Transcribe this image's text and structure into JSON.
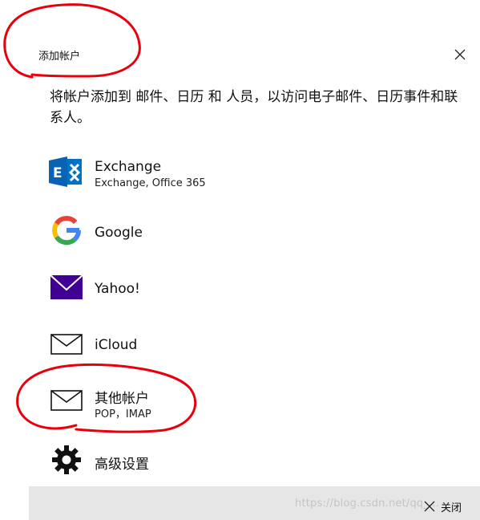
{
  "dialog": {
    "title": "添加帐户",
    "description": "将帐户添加到 邮件、日历 和 人员，以访问电子邮件、日历事件和联系人。"
  },
  "accounts": [
    {
      "name": "Exchange",
      "sub": "Exchange, Office 365",
      "icon": "exchange-icon",
      "color": "#0072c6"
    },
    {
      "name": "Google",
      "sub": "",
      "icon": "google-icon"
    },
    {
      "name": "Yahoo!",
      "sub": "",
      "icon": "yahoo-mail-icon",
      "color": "#410093"
    },
    {
      "name": "iCloud",
      "sub": "",
      "icon": "envelope-icon"
    },
    {
      "name": "其他帐户",
      "sub": "POP，IMAP",
      "icon": "envelope-icon"
    },
    {
      "name": "高级设置",
      "sub": "",
      "icon": "gear-icon"
    }
  ],
  "footer": {
    "close_label": "关闭",
    "watermark": "https://blog.csdn.net/qq_..."
  },
  "colors": {
    "annotation": "#e8000b",
    "footer_bg": "#e6e6e6"
  }
}
